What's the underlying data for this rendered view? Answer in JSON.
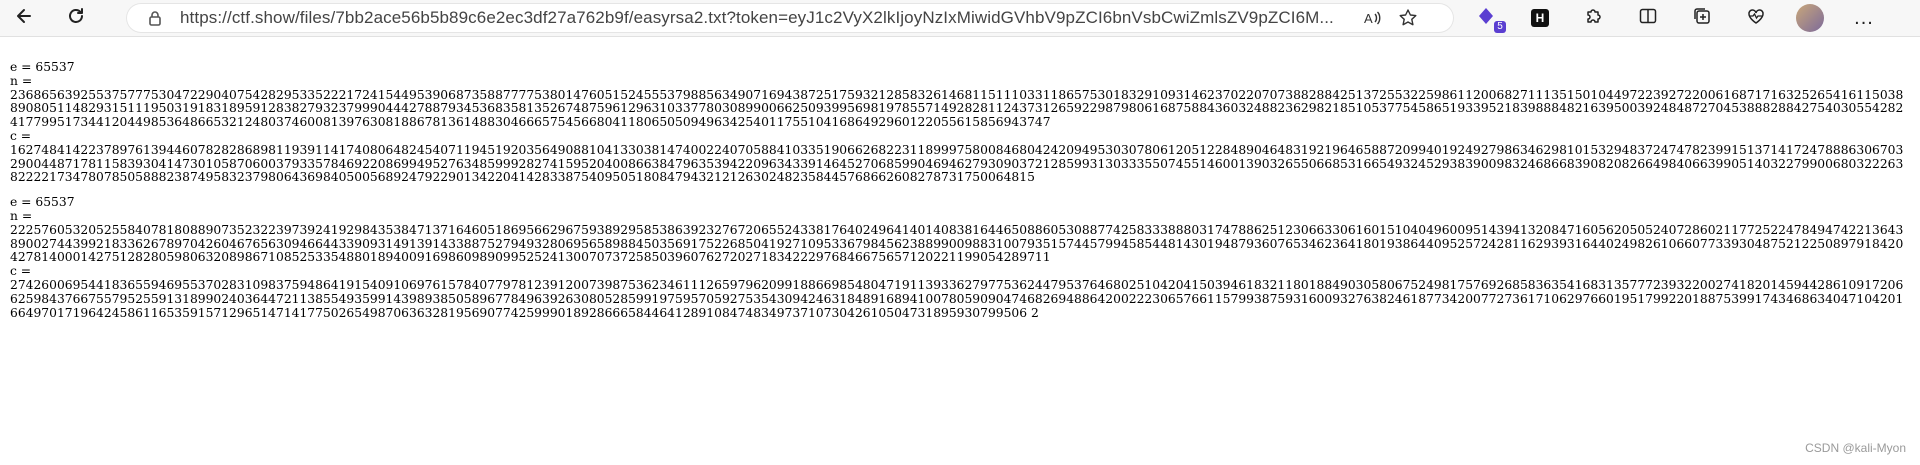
{
  "browser": {
    "url": "https://ctf.show/files/7bb2ace56b5b89c6e2ec3df27a762b9f/easyrsa2.txt?token=eyJ1c2VyX2lkIjoyNzIxMiwidGVhbV9pZCI6bnVsbCwiZmlsZV9pZCI6M...",
    "extension_badge": "5",
    "hx_label": "H",
    "more_label": "..."
  },
  "document": {
    "blocks": [
      {
        "e": "e = 65537",
        "n_label": "n =",
        "n": "23686563925537577753047229040754282953352221724154495390687358877775380147605152455537988563490716943872517593212858326146811511103311865753018329109314623702207073882884251372553225986112006827111351501044972239272200616871716325265416115038890805114829315111950319183189591283827932379990444278879345368358135267487596129631033778030899006625093995698197855714928281124373126592298798061687588436032488236298218510537754586519339521839888482163950039248487270453888288427540305542824177995173441204498536486653212480374600813976308188678136148830466657545668041180650509496342540117551041686492960122055615856943747",
        "c_label": "c =",
        "c": "162748414223789761394460782828689811939114174080648245407119451920356490881041330381474002240705884103351906626822311899975800846804242094953030780612051228489046483192196465887209940192492798634629810153294837247478239915137141724788863067032900448717811583930414730105870600379335784692208699495276348599928274159520400866384796353942209634339146452706859904694627930903721285993130333550745514600139032655066853166549324529383900983246866839082082664984066399051403227990068032226382222173478078505888238749583237980643698405005689247922901342204142833875409505180847943212126302482358445768662608278731750064815"
      },
      {
        "e": "e = 65537",
        "n_label": "n =",
        "n": "22257605320525584078180889073523223973924192984353847137164605186956629675938929585386392327672065524338176402496414014083816446508860530887742583338880317478862512306633061601510404960095143941320847160562050524072860211772522478494742213643890027443992183362678970426046765630946644339093149139143388752794932806956589884503569175226850419271095336798456238899009883100793515744579945854481430194879360765346236418019386440952572428116293931644024982610660773393048752122508979184204278140001427512828059806320898671085253354880189400916986098909952524130070737258503960762720271834222976846675657120221199054289711",
        "c_label": "c =",
        "c": "27426006954418365594695537028310983759486419154091069761578407797812391200739875362346111265979620991886698548047191139336279775362447953764680251042041503946183211801884903058067524981757692685836354168313577723932200274182014594428610917206625984376675579525591318990240364472113855493599143989385058967784963926308052859919759570592753543094246318489168941007805909047468269488642002223065766115799387593160093276382461877342007727361710629766019517992201887539917434686340471042016649701719642458611653591571296514714177502654987063632819569077425999018928666584464128910847483497371073042610504731895930799506 2"
      }
    ]
  },
  "watermark": "CSDN @kali-Myon"
}
